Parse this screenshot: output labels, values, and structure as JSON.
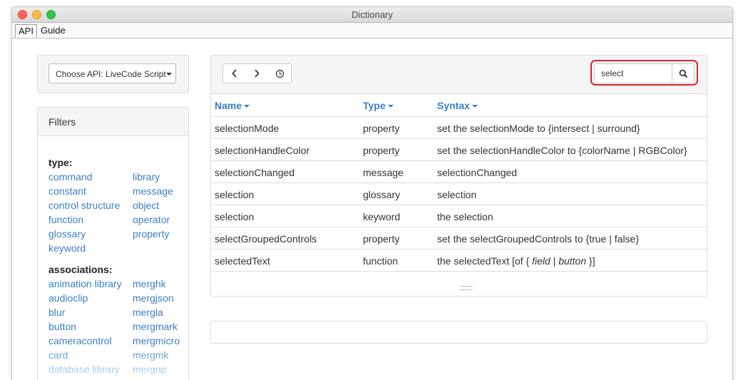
{
  "window": {
    "title": "Dictionary"
  },
  "tabs": [
    {
      "label": "API"
    },
    {
      "label": "Guide"
    }
  ],
  "api_select": {
    "label": "Choose API: LiveCode Script"
  },
  "filters": {
    "heading": "Filters",
    "type_title": "type:",
    "type_items": [
      "command",
      "library",
      "constant",
      "message",
      "control structure",
      "object",
      "function",
      "operator",
      "glossary",
      "property",
      "keyword"
    ],
    "assoc_title": "associations:",
    "assoc_items": [
      "animation library",
      "merghk",
      "audioclip",
      "mergjson",
      "blur",
      "mergla",
      "button",
      "mergmark",
      "cameracontrol",
      "mergmicro",
      "card",
      "mergmk",
      "database library",
      "mergnp"
    ]
  },
  "search": {
    "value": "select",
    "icon": "search-icon"
  },
  "nav": {
    "back_icon": "chevron-left-icon",
    "forward_icon": "chevron-right-icon",
    "history_icon": "clock-icon"
  },
  "table": {
    "headers": {
      "name": "Name",
      "type": "Type",
      "syntax": "Syntax"
    },
    "rows": [
      {
        "name": "selectionMode",
        "type": "property",
        "syntax": "set the selectionMode to {intersect | surround}"
      },
      {
        "name": "selectionHandleColor",
        "type": "property",
        "syntax": "set the selectionHandleColor to {colorName | RGBColor}"
      },
      {
        "name": "selectionChanged",
        "type": "message",
        "syntax": "selectionChanged"
      },
      {
        "name": "selection",
        "type": "glossary",
        "syntax": "selection"
      },
      {
        "name": "selection",
        "type": "keyword",
        "syntax": "the selection"
      },
      {
        "name": "selectGroupedControls",
        "type": "property",
        "syntax": "set the selectGroupedControls to {true | false}"
      },
      {
        "name": "selectedText",
        "type": "function",
        "syntax_prefix": "the selectedText [of { ",
        "syntax_field": "field",
        "syntax_sep": " | ",
        "syntax_button": "button",
        "syntax_suffix": " }]"
      }
    ]
  },
  "colors": {
    "link": "#3b7fc4",
    "search_highlight": "#d9262b"
  }
}
